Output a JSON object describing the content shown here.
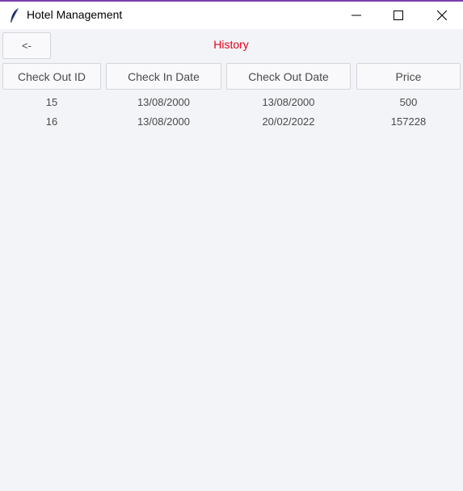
{
  "window": {
    "title": "Hotel Management",
    "app_icon": "feather-icon",
    "accent_color": "#7a3fb0"
  },
  "toolbar": {
    "back_label": "<-",
    "page_title": "History",
    "page_title_color": "#e3001b"
  },
  "table": {
    "headers": [
      "Check Out ID",
      "Check In Date",
      "Check Out Date",
      "Price"
    ],
    "rows": [
      [
        "15",
        "13/08/2000",
        "13/08/2000",
        "500"
      ],
      [
        "16",
        "13/08/2000",
        "20/02/2022",
        "157228"
      ]
    ]
  }
}
